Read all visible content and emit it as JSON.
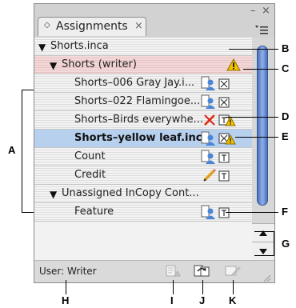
{
  "panel": {
    "tab": {
      "label": "Assignments",
      "arrow": "◇",
      "close": "×"
    },
    "controls": {
      "minimize": "–",
      "close": "×"
    },
    "menu_icon": "panel-menu-icon"
  },
  "rows": [
    {
      "label": "Shorts.inca",
      "expanded": true,
      "level": 0
    },
    {
      "label": "Shorts (writer)",
      "expanded": true,
      "level": 1,
      "status_icon": "warning-icon"
    },
    {
      "label": "Shorts–006 Gray Jay.i...",
      "level": 2,
      "icons": [
        "user-icon",
        "box-x-icon"
      ]
    },
    {
      "label": "Shorts–022 Flamingoe...",
      "level": 2,
      "icons": [
        "user-icon",
        "box-x-icon"
      ]
    },
    {
      "label": "Shorts–Birds everywhe...",
      "level": 2,
      "icons": [
        "crossed-pencil-icon",
        "text-warning-icon"
      ]
    },
    {
      "label": "Shorts–yellow leaf.incx",
      "level": 2,
      "selected": true,
      "icons": [
        "user-icon",
        "x-warning-icon"
      ]
    },
    {
      "label": "Count",
      "level": 2,
      "icons": [
        "user-icon",
        "text-frame-icon"
      ]
    },
    {
      "label": "Credit",
      "level": 2,
      "icons": [
        "pencil-icon",
        "text-frame-icon"
      ]
    },
    {
      "label": "Unassigned InCopy Cont...",
      "expanded": true,
      "level": 1
    },
    {
      "label": "Feature",
      "level": 2,
      "icons": [
        "user-icon",
        "text-frame-icon"
      ]
    }
  ],
  "status": {
    "user_text": "User: Writer",
    "buttons": [
      "update-content-icon",
      "relink-icon",
      "edit-assignment-icon"
    ]
  },
  "callouts": {
    "A": "A",
    "B": "B",
    "C": "C",
    "D": "D",
    "E": "E",
    "F": "F",
    "G": "G",
    "H": "H",
    "I": "I",
    "J": "J",
    "K": "K"
  },
  "colors": {
    "selected_row": "#b7d0ee",
    "writer_row": "#f3dada",
    "scroll_thumb": "#6b8fd6",
    "warning": "#f2c200"
  }
}
